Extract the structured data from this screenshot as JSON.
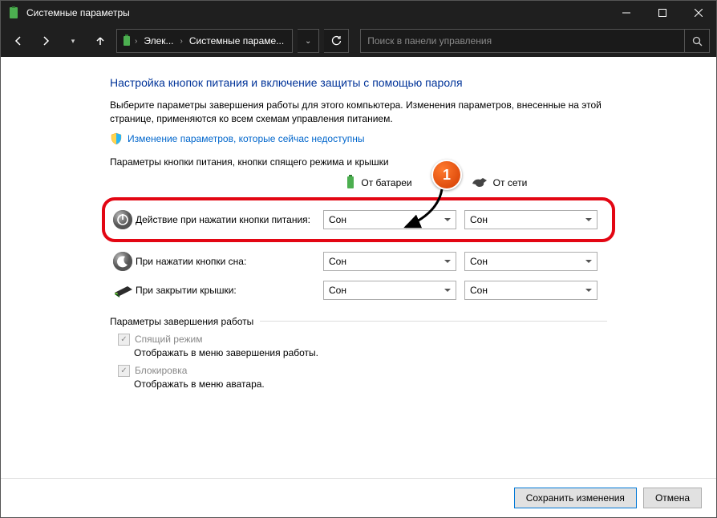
{
  "window": {
    "title": "Системные параметры"
  },
  "nav": {
    "crumb1": "Элек...",
    "crumb2": "Системные параме...",
    "search_placeholder": "Поиск в панели управления"
  },
  "page": {
    "heading": "Настройка кнопок питания и включение защиты с помощью пароля",
    "description": "Выберите параметры завершения работы для этого компьютера. Изменения параметров, внесенные на этой странице, применяются ко всем схемам управления питанием.",
    "change_link": "Изменение параметров, которые сейчас недоступны",
    "section_buttons": "Параметры кнопки питания, кнопки спящего режима и крышки",
    "col_battery": "От батареи",
    "col_plugged": "От сети",
    "row_power": "Действие при нажатии кнопки питания:",
    "row_sleep": "При нажатии кнопки сна:",
    "row_lid": "При закрытии крышки:",
    "val_sleep": "Сон",
    "section_shutdown": "Параметры завершения работы",
    "chk_sleep_label": "Спящий режим",
    "chk_sleep_sub": "Отображать в меню завершения работы.",
    "chk_lock_label": "Блокировка",
    "chk_lock_sub": "Отображать в меню аватара."
  },
  "footer": {
    "save": "Сохранить изменения",
    "cancel": "Отмена"
  },
  "annotation": {
    "badge": "1"
  }
}
